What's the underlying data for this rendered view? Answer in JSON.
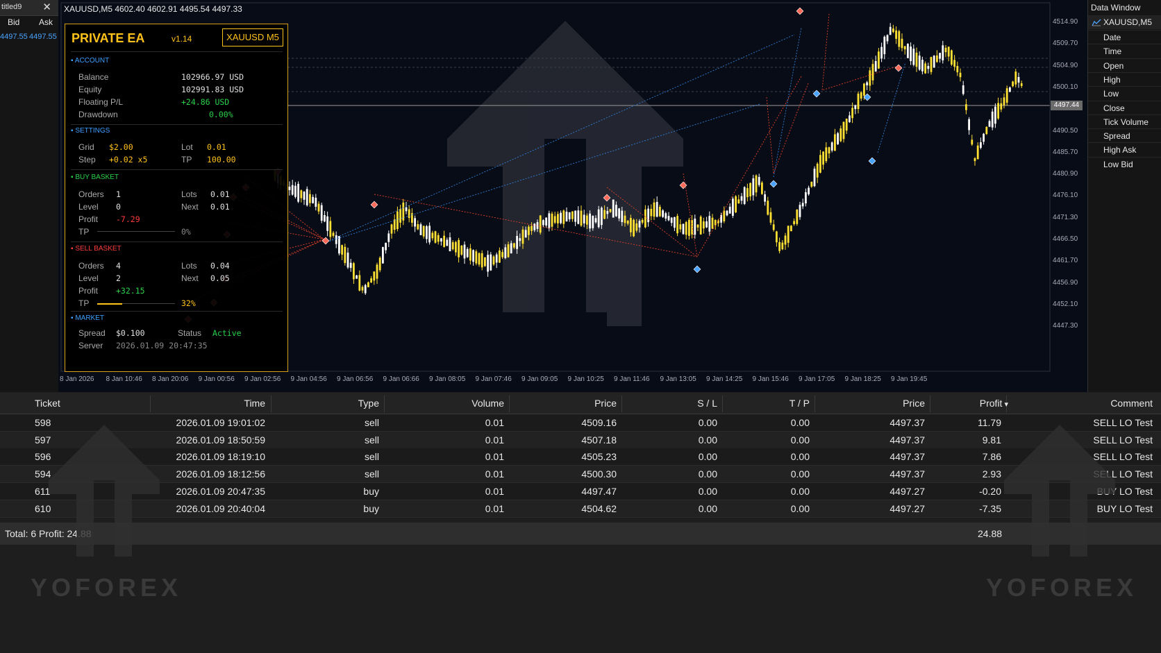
{
  "market_watch": {
    "tab_title": "titled9",
    "close_label": "✕",
    "bid_label": "Bid",
    "ask_label": "Ask",
    "bid_value": "4497.55",
    "ask_value": "4497.55"
  },
  "chart": {
    "symbol_line": "XAUUSD,M5  4602.40 4602.91 4495.54 4497.33",
    "current_price": "4497.44",
    "price_ticks": [
      "4514.90",
      "4509.70",
      "4504.90",
      "4500.10",
      "4495.30",
      "4490.50",
      "4485.70",
      "4480.90",
      "4476.10",
      "4471.30",
      "4466.50",
      "4461.70",
      "4456.90",
      "4452.10",
      "4447.30"
    ],
    "time_ticks": [
      "8 Jan 2026",
      "8 Jan 10:46",
      "8 Jan 20:06",
      "9 Jan 00:56",
      "9 Jan 02:56",
      "9 Jan 04:56",
      "9 Jan 06:56",
      "9 Jan 06:66",
      "9 Jan 08:05",
      "9 Jan 07:46",
      "9 Jan 09:05",
      "9 Jan 10:25",
      "9 Jan 11:46",
      "9 Jan 13:05",
      "9 Jan 14:25",
      "9 Jan 15:46",
      "9 Jan 17:05",
      "9 Jan 18:25",
      "9 Jan 19:45"
    ],
    "colors": {
      "bull": "#ffe033",
      "bear": "#ffffff",
      "buy_line": "#2f7fd8",
      "sell_line": "#e0402a",
      "background": "#080c16"
    }
  },
  "ea_panel": {
    "title": "PRIVATE EA",
    "version": "v1.14",
    "symbol": "XAUUSD M5",
    "account": {
      "heading": "ACCOUNT",
      "balance_label": "Balance",
      "balance": "102966.97 USD",
      "equity_label": "Equity",
      "equity": "102991.83 USD",
      "floating_label": "Floating P/L",
      "floating": "+24.86 USD",
      "drawdown_label": "Drawdown",
      "drawdown": "0.00%"
    },
    "settings": {
      "heading": "SETTINGS",
      "grid_label": "Grid",
      "grid": "$2.00",
      "lot_label": "Lot",
      "lot": "0.01",
      "step_label": "Step",
      "step": "+0.02 x5",
      "tp_label": "TP",
      "tp": "100.00"
    },
    "buy_basket": {
      "heading": "BUY BASKET",
      "orders_label": "Orders",
      "orders": "1",
      "lots_label": "Lots",
      "lots": "0.01",
      "level_label": "Level",
      "level": "0",
      "next_label": "Next",
      "next": "0.01",
      "profit_label": "Profit",
      "profit": "-7.29",
      "tp_label": "TP",
      "tp_progress": "0%",
      "tp_fraction": 0
    },
    "sell_basket": {
      "heading": "SELL BASKET",
      "orders_label": "Orders",
      "orders": "4",
      "lots_label": "Lots",
      "lots": "0.04",
      "level_label": "Level",
      "level": "2",
      "next_label": "Next",
      "next": "0.05",
      "profit_label": "Profit",
      "profit": "+32.15",
      "tp_label": "TP",
      "tp_progress": "32%",
      "tp_fraction": 0.32
    },
    "market": {
      "heading": "MARKET",
      "spread_label": "Spread",
      "spread": "$0.100",
      "status_label": "Status",
      "status": "Active",
      "server_label": "Server",
      "server": "2026.01.09 20:47:35"
    }
  },
  "data_window": {
    "title": "Data Window",
    "symbol": "XAUUSD,M5",
    "rows": [
      "Date",
      "Time",
      "Open",
      "High",
      "Low",
      "Close",
      "Tick Volume",
      "Spread",
      "High Ask",
      "Low Bid"
    ]
  },
  "trade_table": {
    "headers": [
      "Ticket",
      "Time",
      "Type",
      "Volume",
      "Price",
      "S / L",
      "T / P",
      "Price",
      "Profit",
      "Comment"
    ],
    "rows": [
      [
        "598",
        "2026.01.09 19:01:02",
        "sell",
        "0.01",
        "4509.16",
        "0.00",
        "0.00",
        "4497.37",
        "11.79",
        "SELL LO Test"
      ],
      [
        "597",
        "2026.01.09 18:50:59",
        "sell",
        "0.01",
        "4507.18",
        "0.00",
        "0.00",
        "4497.37",
        "9.81",
        "SELL LO Test"
      ],
      [
        "596",
        "2026.01.09 18:19:10",
        "sell",
        "0.01",
        "4505.23",
        "0.00",
        "0.00",
        "4497.37",
        "7.86",
        "SELL LO Test"
      ],
      [
        "594",
        "2026.01.09 18:12:56",
        "sell",
        "0.01",
        "4500.30",
        "0.00",
        "0.00",
        "4497.37",
        "2.93",
        "SELL LO Test"
      ],
      [
        "611",
        "2026.01.09 20:47:35",
        "buy",
        "0.01",
        "4497.47",
        "0.00",
        "0.00",
        "4497.27",
        "-0.20",
        "BUY LO Test"
      ],
      [
        "610",
        "2026.01.09 20:40:04",
        "buy",
        "0.01",
        "4504.62",
        "0.00",
        "0.00",
        "4497.27",
        "-7.35",
        "BUY LO Test"
      ]
    ],
    "total_label": "Total:  6    Profit: 24.88",
    "total_profit": "24.88",
    "sort_icon": "▾"
  },
  "watermark": {
    "text": "YOFOREX"
  }
}
